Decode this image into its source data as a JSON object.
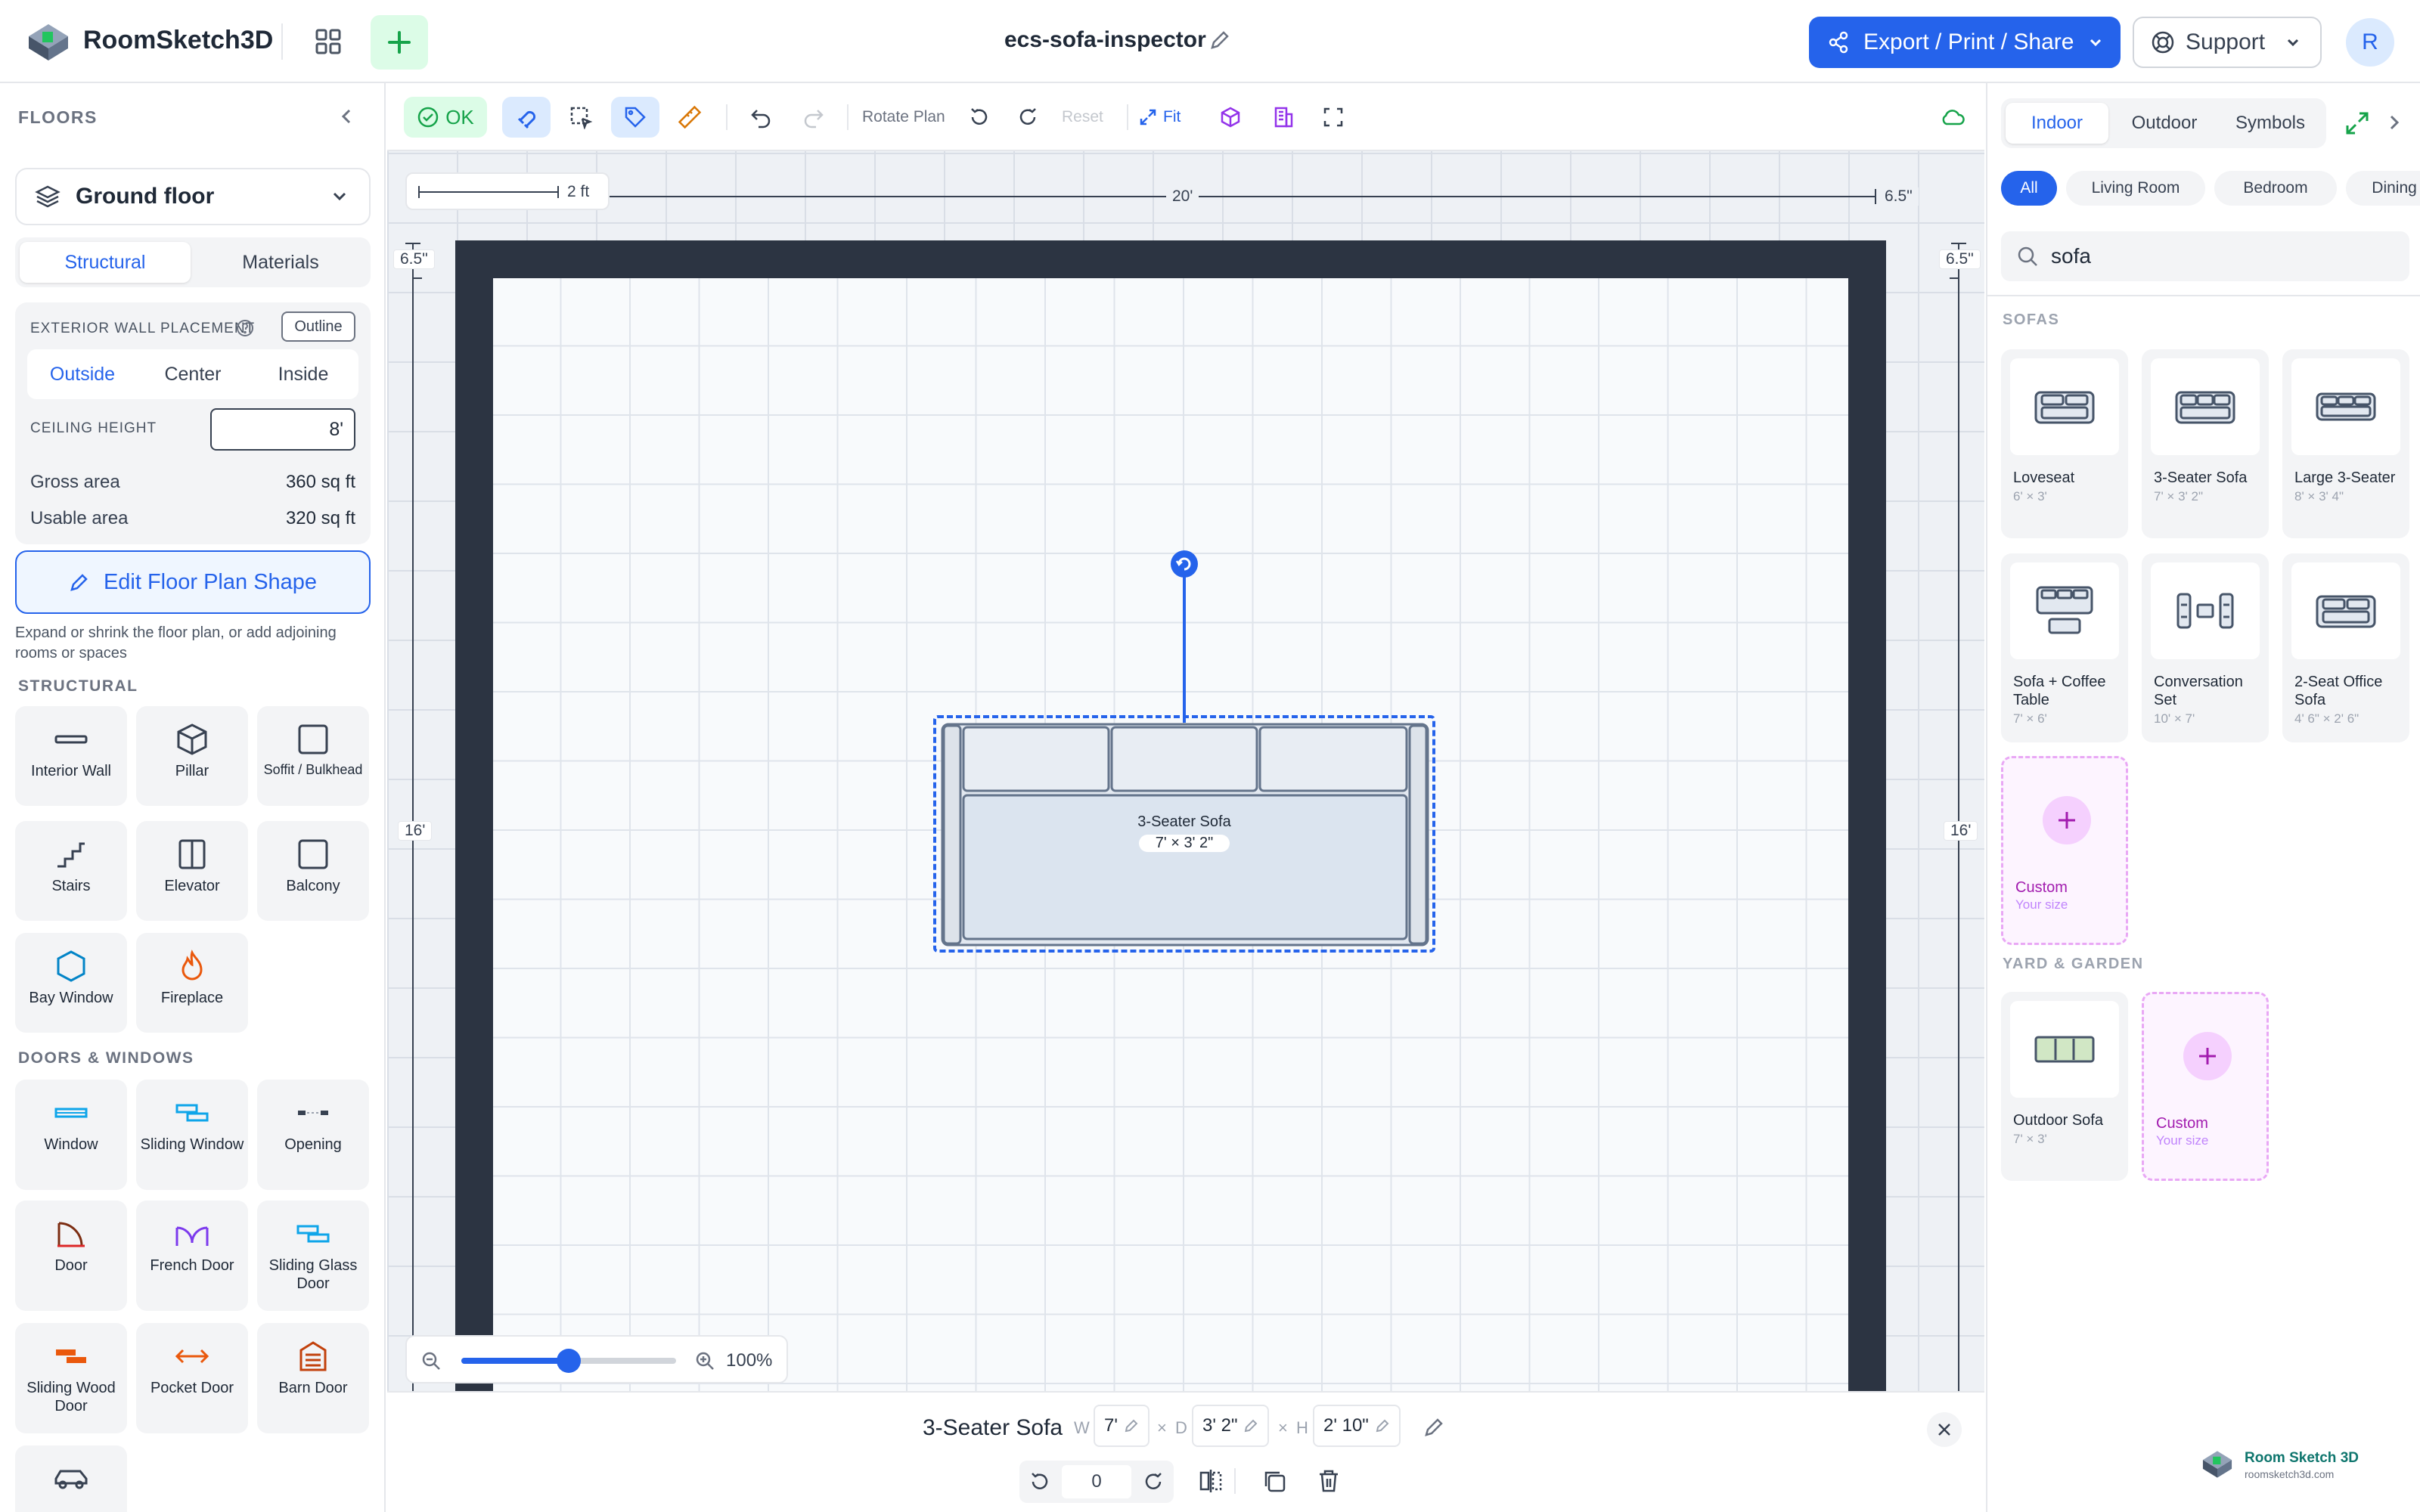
{
  "app": {
    "name": "RoomSketch3D",
    "document_title": "ecs-sofa-inspector"
  },
  "header": {
    "export_label": "Export / Print / Share",
    "support_label": "Support",
    "avatar_initial": "R"
  },
  "left": {
    "floors_title": "FLOORS",
    "floor_selected": "Ground floor",
    "tabs": [
      "Structural",
      "Materials"
    ],
    "wall_placement_label": "EXTERIOR WALL PLACEMENT",
    "outline_label": "Outline",
    "placement_options": [
      "Outside",
      "Center",
      "Inside"
    ],
    "ceiling_label": "CEILING HEIGHT",
    "ceiling_value": "8'",
    "gross_label": "Gross area",
    "gross_value": "360 sq ft",
    "usable_label": "Usable area",
    "usable_value": "320 sq ft",
    "edit_label": "Edit Floor Plan Shape",
    "edit_help": "Expand or shrink the floor plan, or add adjoining rooms or spaces",
    "structural_title": "STRUCTURAL",
    "structural_items": [
      "Interior Wall",
      "Pillar",
      "Soffit / Bulkhead",
      "Stairs",
      "Elevator",
      "Balcony",
      "Bay Window",
      "Fireplace"
    ],
    "doors_title": "DOORS & WINDOWS",
    "door_items": [
      "Window",
      "Sliding Window",
      "Opening",
      "Door",
      "French Door",
      "Sliding Glass Door",
      "Sliding Wood Door",
      "Pocket Door",
      "Barn Door"
    ]
  },
  "toolbar": {
    "ok_label": "OK",
    "rotate_label": "Rotate Plan",
    "reset_label": "Reset",
    "fit_label": "Fit"
  },
  "canvas": {
    "scale_label": "2 ft",
    "dim_top": "20'",
    "dim_top_right": "6.5\"",
    "dim_left_top": "6.5\"",
    "dim_right_top": "6.5\"",
    "dim_left": "16'",
    "dim_right": "16'",
    "zoom_value": "100%",
    "zoom_fraction": 0.5,
    "sofa_name": "3-Seater Sofa",
    "sofa_size": "7' × 3' 2\""
  },
  "inspector": {
    "name": "3-Seater Sofa",
    "w_label": "W",
    "w_value": "7'",
    "d_label": "D",
    "d_value": "3' 2\"",
    "h_label": "H",
    "h_value": "2' 10\"",
    "x1": "×",
    "x2": "×",
    "rotation_value": "0"
  },
  "right": {
    "tabs": [
      "Indoor",
      "Outdoor",
      "Symbols"
    ],
    "chips": [
      "All",
      "Living Room",
      "Bedroom",
      "Dining Room"
    ],
    "search_value": "sofa",
    "sofas_title": "SOFAS",
    "sofas": [
      {
        "name": "Loveseat",
        "size": "6' × 3'"
      },
      {
        "name": "3-Seater Sofa",
        "size": "7' × 3' 2\""
      },
      {
        "name": "Large 3-Seater",
        "size": "8' × 3' 4\""
      },
      {
        "name": "Sofa + Coffee Table",
        "size": "7' × 6'"
      },
      {
        "name": "Conversation Set",
        "size": "10' × 7'"
      },
      {
        "name": "2-Seat Office Sofa",
        "size": "4' 6\" × 2' 6\""
      }
    ],
    "custom_label": "Custom",
    "custom_sub": "Your size",
    "yard_title": "YARD & GARDEN",
    "yard": [
      {
        "name": "Outdoor Sofa",
        "size": "7' × 3'"
      }
    ],
    "footer_brand": "Room Sketch 3D",
    "footer_url": "roomsketch3d.com"
  }
}
